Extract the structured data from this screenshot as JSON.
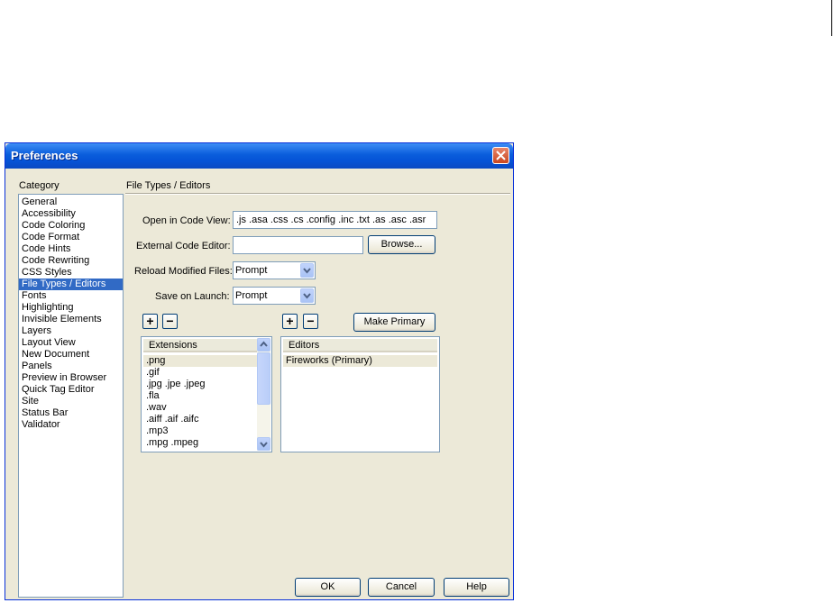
{
  "dialog": {
    "title": "Preferences"
  },
  "category": {
    "label": "Category",
    "items": [
      "General",
      "Accessibility",
      "Code Coloring",
      "Code Format",
      "Code Hints",
      "Code Rewriting",
      "CSS Styles",
      "File Types / Editors",
      "Fonts",
      "Highlighting",
      "Invisible Elements",
      "Layers",
      "Layout View",
      "New Document",
      "Panels",
      "Preview in Browser",
      "Quick Tag Editor",
      "Site",
      "Status Bar",
      "Validator"
    ],
    "selected": "File Types / Editors"
  },
  "panel": {
    "title": "File Types / Editors",
    "open_in_code_view": {
      "label": "Open in Code View:",
      "value": ".js .asa .css .cs .config .inc .txt .as .asc .asr"
    },
    "external_editor": {
      "label": "External Code Editor:",
      "value": "",
      "browse_label": "Browse..."
    },
    "reload_modified": {
      "label": "Reload Modified Files:",
      "value": "Prompt"
    },
    "save_on_launch": {
      "label": "Save on Launch:",
      "value": "Prompt"
    },
    "plus": "+",
    "minus": "−",
    "make_primary_label": "Make Primary",
    "extensions": {
      "header": "Extensions",
      "rows": [
        ".png",
        ".gif",
        ".jpg .jpe .jpeg",
        ".fla",
        ".wav",
        ".aiff .aif .aifc",
        ".mp3",
        ".mpg .mpeg"
      ],
      "selected": ".png"
    },
    "editors": {
      "header": "Editors",
      "rows": [
        "Fireworks (Primary)"
      ],
      "selected": "Fireworks (Primary)"
    }
  },
  "footer": {
    "ok_label": "OK",
    "cancel_label": "Cancel",
    "help_label": "Help"
  }
}
